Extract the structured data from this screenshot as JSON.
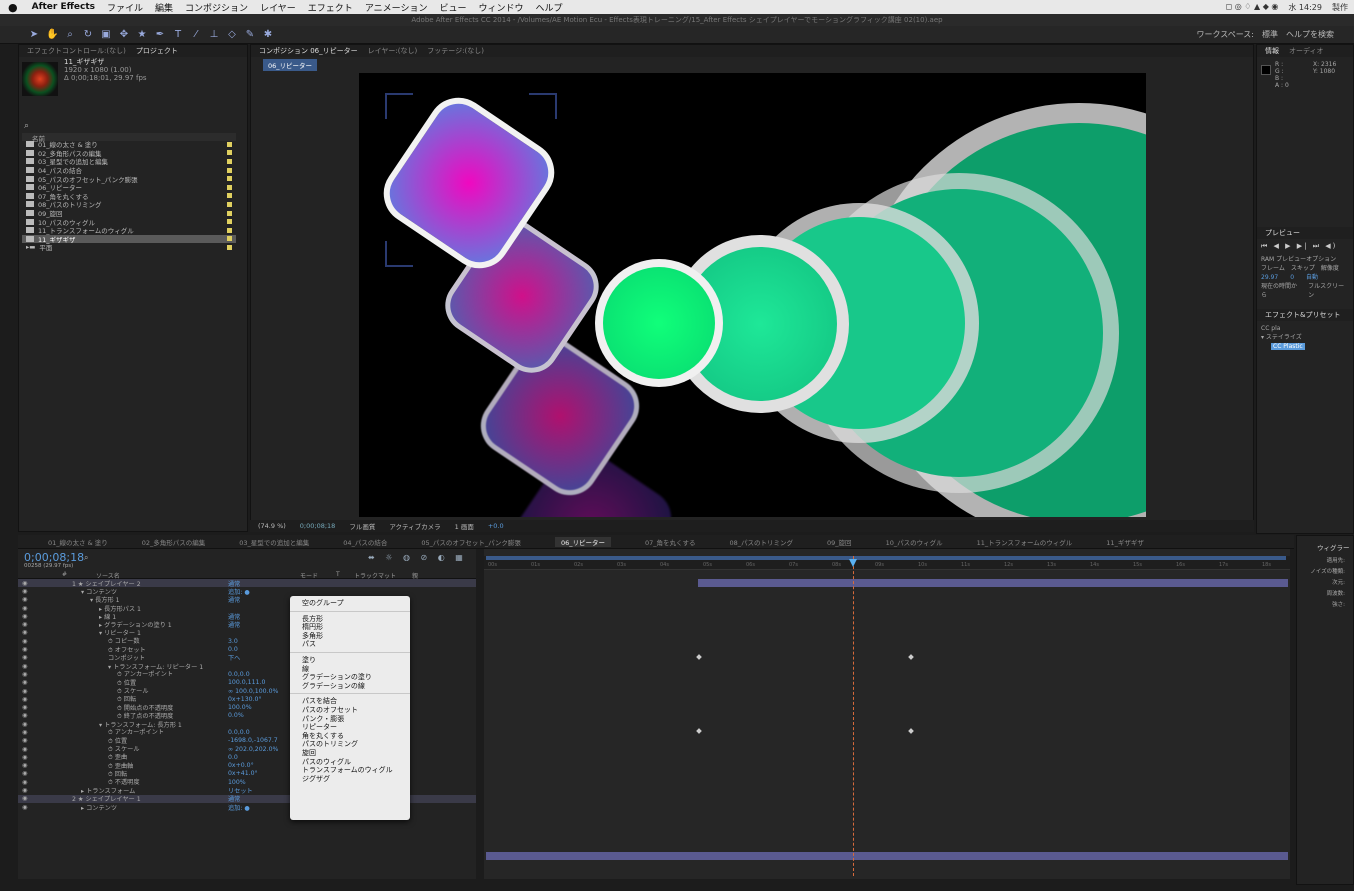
{
  "menubar": {
    "apple": "",
    "app": "After Effects",
    "items": [
      "ファイル",
      "編集",
      "コンポジション",
      "レイヤー",
      "エフェクト",
      "アニメーション",
      "ビュー",
      "ウィンドウ",
      "ヘルプ"
    ],
    "clock": "水 14:29",
    "user": "製作"
  },
  "titlebar": {
    "text": "Adobe After Effects CC 2014 - /Volumes/AE Motion Ecu - Effects表現トレーニング/15_After Effects シェイプレイヤーでモーショングラフィック講座 02(10).aep"
  },
  "toolbar": {
    "workspace": "ワークスペース:",
    "workspace_value": "標準",
    "search_placeholder": "ヘルプを検索"
  },
  "project": {
    "tabs": [
      "エフェクトコントロール:(なし)",
      "プロジェクト"
    ],
    "item_name": "11_ギザギザ",
    "item_info": [
      "1920 x 1080 (1.00)",
      "Δ 0;00;18;01, 29.97 fps"
    ],
    "search_icon": "search-icon",
    "header": "名前",
    "files": [
      "01_線の太さ & 塗り",
      "02_多角形パスの編集",
      "03_星型での追加と編集",
      "04_パスの結合",
      "05_パスのオフセット_パンク膨張",
      "06_リピーター",
      "07_角を丸くする",
      "08_パスのトリミング",
      "09_旋回",
      "10_パスのウィグル",
      "11_トランスフォームのウィグル",
      "11_ギザギザ",
      "平面"
    ]
  },
  "comp": {
    "tabs": [
      "コンポジション 06_リピーター",
      "レイヤー:(なし)",
      "フッテージ:(なし)"
    ],
    "sub_tab": "06_リピーター",
    "footer": {
      "zoom": "(74.9 %)",
      "timecode": "0;00;08;18",
      "quality": "フル画質",
      "camera": "アクティブカメラ",
      "views": "1 画面",
      "exposure": "+0.0"
    }
  },
  "right": {
    "info_tabs": [
      "情報",
      "オーディオ"
    ],
    "info_lines": [
      "R :",
      "G :",
      "B :",
      "A : 0"
    ],
    "coords": [
      "X: 2316",
      "Y: 1080"
    ],
    "preview_tab": "プレビュー",
    "preview_opts": "RAM プレビューオプション",
    "preview_labels": [
      "フレーム",
      "スキップ",
      "解像度"
    ],
    "preview_vals": [
      "29.97",
      "0",
      "自動"
    ],
    "preview_btns": [
      "現在の時間から",
      "フルスクリーン"
    ],
    "effects_tab": "エフェクト&プリセット",
    "effects_search": "CC pla",
    "effects_folder": "▾ ステイライズ",
    "effects_item": "CC Plastic"
  },
  "timeline": {
    "tabs": [
      "01_線の太さ & 塗り",
      "02_多角形パスの編集",
      "03_星型での追加と編集",
      "04_パスの結合",
      "05_パスのオフセット_パンク膨張",
      "06_リピーター",
      "07_角を丸くする",
      "08_パスのトリミング",
      "09_旋回",
      "10_パスのウィグル",
      "11_トランスフォームのウィグル",
      "11_ギザギザ"
    ],
    "active_tab": 5,
    "timecode": "0;00;08;18",
    "fps": "00258 (29.97 fps)",
    "columns": [
      "#",
      "ソース名",
      "モード",
      "T",
      "トラックマット",
      "親"
    ],
    "ticks": [
      "00s",
      "01s",
      "02s",
      "03s",
      "04s",
      "05s",
      "06s",
      "07s",
      "08s",
      "09s",
      "10s",
      "11s",
      "12s",
      "13s",
      "14s",
      "15s",
      "16s",
      "17s",
      "18s"
    ],
    "rows": [
      {
        "label": "1  ★ シェイプレイヤー 2",
        "value": "通常",
        "indent": 0,
        "bar": true
      },
      {
        "label": "▾ コンテンツ",
        "value": "追加: ●",
        "indent": 1
      },
      {
        "label": "▾ 長方形 1",
        "value": "通常",
        "indent": 2
      },
      {
        "label": "▸ 長方形パス 1",
        "value": "",
        "indent": 3
      },
      {
        "label": "▸ 線 1",
        "value": "通常",
        "indent": 3
      },
      {
        "label": "▸ グラデーションの塗り 1",
        "value": "通常",
        "indent": 3
      },
      {
        "label": "▾ リピーター 1",
        "value": "",
        "indent": 3
      },
      {
        "label": "⏱ コピー数",
        "value": "3.0",
        "indent": 4
      },
      {
        "label": "⏱ オフセット",
        "value": "0.0",
        "indent": 4
      },
      {
        "label": "コンポジット",
        "value": "下へ",
        "indent": 4
      },
      {
        "label": "▾ トランスフォーム: リピーター 1",
        "value": "",
        "indent": 4
      },
      {
        "label": "⏱ アンカーポイント",
        "value": "0.0,0.0",
        "indent": 5
      },
      {
        "label": "⏱ 位置",
        "value": "100.0,111.0",
        "indent": 5
      },
      {
        "label": "⏱ スケール",
        "value": "∞ 100.0,100.0%",
        "indent": 5
      },
      {
        "label": "⏱ 回転",
        "value": "0x+130.0°",
        "indent": 5
      },
      {
        "label": "⏱ 開始点の不透明度",
        "value": "100.0%",
        "indent": 5
      },
      {
        "label": "⏱ 終了点の不透明度",
        "value": "0.0%",
        "indent": 5
      },
      {
        "label": "▾ トランスフォーム: 長方形 1",
        "value": "",
        "indent": 3
      },
      {
        "label": "⏱ アンカーポイント",
        "value": "0.0,0.0",
        "indent": 4
      },
      {
        "label": "⏱ 位置",
        "value": "-1698.0,-1067.7",
        "indent": 4
      },
      {
        "label": "⏱ スケール",
        "value": "∞ 202.0,202.0%",
        "indent": 4
      },
      {
        "label": "⏱ 歪曲",
        "value": "0.0",
        "indent": 4
      },
      {
        "label": "⏱ 歪曲軸",
        "value": "0x+0.0°",
        "indent": 4
      },
      {
        "label": "⏱ 回転",
        "value": "0x+41.0°",
        "indent": 4
      },
      {
        "label": "⏱ 不透明度",
        "value": "100%",
        "indent": 4
      },
      {
        "label": "▸ トランスフォーム",
        "value": "リセット",
        "indent": 1
      },
      {
        "label": "2  ★ シェイプレイヤー 1",
        "value": "通常",
        "indent": 0,
        "bar": true
      },
      {
        "label": "▸ コンテンツ",
        "value": "追加: ●",
        "indent": 1
      }
    ]
  },
  "context_menu": {
    "groups": [
      [
        "空のグループ"
      ],
      [
        "長方形",
        "楕円形",
        "多角形",
        "パス"
      ],
      [
        "塗り",
        "線",
        "グラデーションの塗り",
        "グラデーションの線"
      ],
      [
        "パスを結合",
        "パスのオフセット",
        "パンク・膨張",
        "リピーター",
        "角を丸くする",
        "パスのトリミング",
        "旋回",
        "パスのウィグル",
        "トランスフォームのウィグル",
        "ジグザグ"
      ]
    ]
  },
  "wiggler": {
    "tab": "ウィグラー",
    "labels": [
      "適用先:",
      "ノイズの種類:",
      "次元:",
      "周波数:",
      "強さ:"
    ]
  },
  "colors": {
    "accent": "#5a9bdc",
    "playhead": "#d86a3a",
    "bg": "#1c1c1c"
  }
}
